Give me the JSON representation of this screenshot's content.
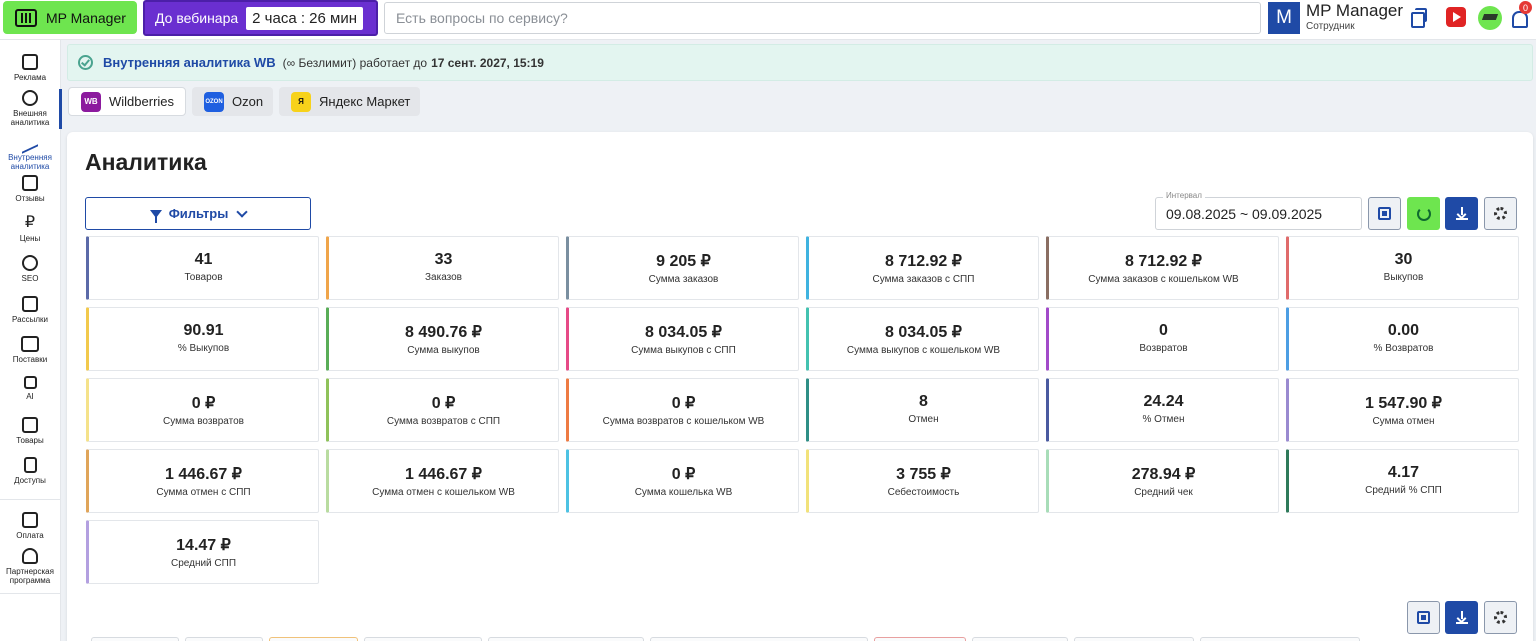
{
  "topbar": {
    "logo": "MP Manager",
    "webinar_label": "До вебинара",
    "webinar_timer": "2 часа : 26 мин",
    "search_placeholder": "Есть вопросы по сервису?",
    "avatar_letter": "M",
    "user_name": "MP Manager",
    "user_role": "Сотрудник",
    "notifications": "0"
  },
  "sidebar": {
    "items": [
      {
        "label": "Реклама",
        "icon": "ads-icon"
      },
      {
        "label": "Внешняя аналитика",
        "icon": "pie-chart-icon"
      },
      {
        "label": "Внутренняя аналитика",
        "icon": "trend-icon"
      },
      {
        "label": "Отзывы",
        "icon": "chat-icon"
      },
      {
        "label": "Цены",
        "icon": "ruble-icon"
      },
      {
        "label": "SEO",
        "icon": "seo-icon"
      },
      {
        "label": "Рассылки",
        "icon": "mail-icon"
      },
      {
        "label": "Поставки",
        "icon": "truck-icon"
      },
      {
        "label": "AI",
        "icon": "chip-icon"
      },
      {
        "label": "Товары",
        "icon": "box-icon"
      },
      {
        "label": "Доступы",
        "icon": "lock-icon"
      },
      {
        "label": "Оплата",
        "icon": "wallet-icon"
      },
      {
        "label": "Партнерская программа",
        "icon": "people-icon"
      }
    ]
  },
  "notice": {
    "title": "Внутренняя аналитика WB",
    "plan": "(∞ Безлимит)",
    "text": "работает до",
    "until": "17 сент. 2027, 15:19"
  },
  "marketplaces": [
    {
      "label": "Wildberries",
      "badge": "WB",
      "color": "#8c1a9e"
    },
    {
      "label": "Ozon",
      "badge": "OZON",
      "color": "#1f5fe0"
    },
    {
      "label": "Яндекс Маркет",
      "badge": "Я",
      "color": "#f7d21a"
    }
  ],
  "main": {
    "title": "Аналитика",
    "filter_label": "Фильтры",
    "interval_label": "Интервал",
    "interval_value": "09.08.2025 ~ 09.09.2025"
  },
  "metrics": [
    {
      "value": "41",
      "label": "Товаров",
      "color": "#5b6aa8"
    },
    {
      "value": "33",
      "label": "Заказов",
      "color": "#f0a54a"
    },
    {
      "value": "9 205 ₽",
      "label": "Сумма заказов",
      "color": "#7a8fa0"
    },
    {
      "value": "8 712.92 ₽",
      "label": "Сумма заказов с СПП",
      "color": "#3fb3e0"
    },
    {
      "value": "8 712.92 ₽",
      "label": "Сумма заказов с кошельком WB",
      "color": "#8a6e62"
    },
    {
      "value": "30",
      "label": "Выкупов",
      "color": "#e06b6b"
    },
    {
      "value": "90.91",
      "label": "% Выкупов",
      "color": "#f2c94c"
    },
    {
      "value": "8 490.76 ₽",
      "label": "Сумма выкупов",
      "color": "#59ad57"
    },
    {
      "value": "8 034.05 ₽",
      "label": "Сумма выкупов с СПП",
      "color": "#e64a87"
    },
    {
      "value": "8 034.05 ₽",
      "label": "Сумма выкупов с кошельком WB",
      "color": "#43c2b0"
    },
    {
      "value": "0",
      "label": "Возвратов",
      "color": "#a24ac9"
    },
    {
      "value": "0.00",
      "label": "% Возвратов",
      "color": "#4d9ee3"
    },
    {
      "value": "0 ₽",
      "label": "Сумма возвратов",
      "color": "#f5e28a"
    },
    {
      "value": "0 ₽",
      "label": "Сумма возвратов с СПП",
      "color": "#8fc25a"
    },
    {
      "value": "0 ₽",
      "label": "Сумма возвратов с кошельком WB",
      "color": "#ee7b43"
    },
    {
      "value": "8",
      "label": "Отмен",
      "color": "#2f8f86"
    },
    {
      "value": "24.24",
      "label": "% Отмен",
      "color": "#4a5aa0"
    },
    {
      "value": "1 547.90 ₽",
      "label": "Сумма отмен",
      "color": "#9a8ad0"
    },
    {
      "value": "1 446.67 ₽",
      "label": "Сумма отмен с СПП",
      "color": "#e0a55a"
    },
    {
      "value": "1 446.67 ₽",
      "label": "Сумма отмен с кошельком WB",
      "color": "#b9dca0"
    },
    {
      "value": "0 ₽",
      "label": "Сумма кошелька WB",
      "color": "#4dc2e3"
    },
    {
      "value": "3 755 ₽",
      "label": "Себестоимость",
      "color": "#f2e27a"
    },
    {
      "value": "278.94 ₽",
      "label": "Средний чек",
      "color": "#a8ddb8"
    },
    {
      "value": "4.17",
      "label": "Средний % СПП",
      "color": "#2f7a5a"
    },
    {
      "value": "14.47 ₽",
      "label": "Средний СПП",
      "color": "#b3a0e0"
    }
  ]
}
